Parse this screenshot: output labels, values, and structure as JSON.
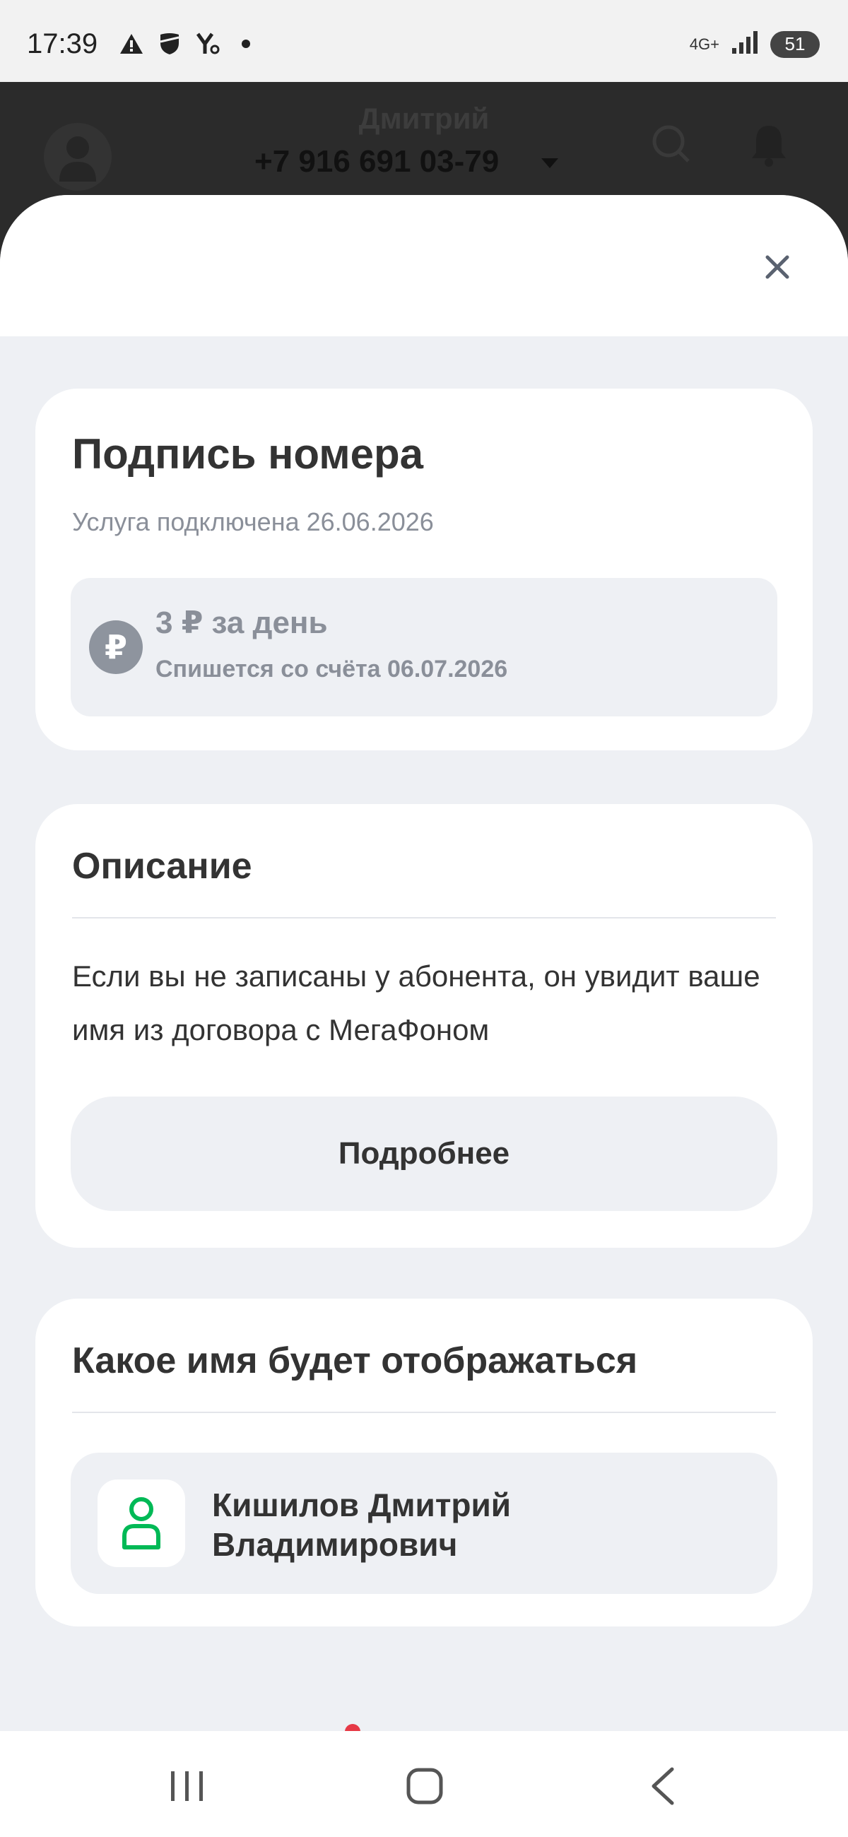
{
  "status_bar": {
    "time": "17:39",
    "network": "4G+",
    "battery": "51",
    "icons": [
      "warning-icon",
      "shield-icon",
      "yandex-icon",
      "dot-icon",
      "signal-icon",
      "battery-icon"
    ]
  },
  "header": {
    "name": "Дмитрий",
    "phone": "+7 916 691 03-79"
  },
  "service": {
    "title": "Подпись номера",
    "status": "Услуга подключена 26.06.2026",
    "price": "3 ₽ за день",
    "charge_note": "Спишется со счёта 06.07.2026",
    "currency_symbol": "₽"
  },
  "description": {
    "title": "Описание",
    "text": "Если вы не записаны у абонента, он увидит ваше имя из договора с МегаФоном",
    "more_label": "Подробнее"
  },
  "display_name": {
    "title": "Какое имя будет отображаться",
    "line1": "Кишилов Дмитрий",
    "line2": "Владимирович"
  },
  "colors": {
    "accent_green": "#00b956",
    "muted_text": "#8a8f99",
    "sheet_bg": "#eef0f4"
  }
}
